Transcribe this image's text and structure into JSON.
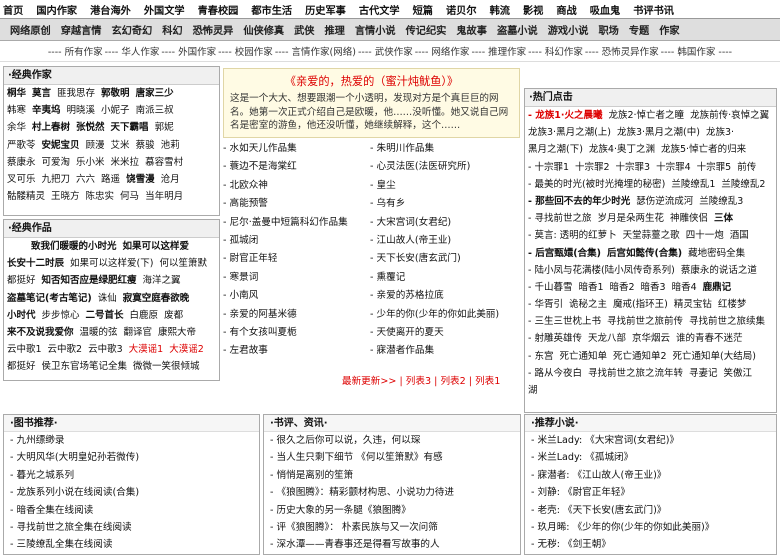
{
  "nav_top": [
    "首页",
    "国内作家",
    "港台海外",
    "外国文学",
    "青春校园",
    "都市生活",
    "历史军事",
    "古代文学",
    "短篇",
    "诺贝尔",
    "韩流",
    "影视",
    "商战",
    "吸血鬼",
    "书评书讯"
  ],
  "nav_second": [
    "网络原创",
    "穿越言情",
    "玄幻奇幻",
    "科幻",
    "恐怖灵异",
    "仙侠修真",
    "武侠",
    "推理",
    "言情小说",
    "传记纪实",
    "鬼故事",
    "盗墓小说",
    "游戏小说",
    "职场",
    "专题",
    "作家"
  ],
  "cat_links": [
    "---- 所有作家",
    "---- 华人作家",
    "---- 外国作家",
    "---- 校园作家",
    "---- 言情作家(网络)",
    "---- 武侠作家",
    "---- 网络作家",
    "---- 推理作家",
    "---- 科幻作家",
    "---- 恐怖灵异作家",
    "---- 韩国作家 ----"
  ],
  "classic_authors": {
    "title": "·经典作家",
    "rows": [
      [
        "桐华",
        "莫言",
        "匪我思存",
        "郭敬明",
        "唐家三少"
      ],
      [
        "韩寒",
        "辛夷坞",
        "明晓溪",
        "小妮子",
        "南派三叔"
      ],
      [
        "余华",
        "村上春树",
        "张悦然",
        "天下霸唱",
        "郭妮"
      ],
      [
        "严歌苓",
        "安妮宝贝",
        "顾漫",
        "艾米",
        "蔡骏",
        "池莉"
      ],
      [
        "蔡康永",
        "可爱淘",
        "乐小米",
        "米米拉",
        "慕容雪村"
      ],
      [
        "叉可乐",
        "九把刀",
        "六六",
        "路遥",
        "饶雪漫",
        "沧月"
      ],
      [
        "骷髅精灵",
        "王晓方",
        "陈忠实",
        "何马",
        "当年明月"
      ]
    ]
  },
  "classic_works": {
    "title": "·经典作品",
    "rows": [
      [
        "致我们暖暖的小时光",
        "如果可以这样爱"
      ],
      [
        "长安十二时辰",
        "如果可以这样爱(下)",
        "何以笙箫默"
      ],
      [
        "都挺好",
        "知否知否应是绿肥红瘦",
        "海洋之翼"
      ],
      [
        "盗墓笔记(考古笔记)",
        "诛仙",
        "寂寞空庭春欲晚"
      ],
      [
        "小时代",
        "步步惊心",
        "二号首长",
        "白鹿原",
        "废都"
      ],
      [
        "来不及说我爱你",
        "温暖的弦",
        "翻译官",
        "康熙大帝"
      ],
      [
        "云中歌1",
        "云中歌2",
        "云中歌3",
        "大漠谣1",
        "大漠谣2"
      ],
      [
        "都挺好",
        "侯卫东官场笔记全集",
        "微微一笑很倾城"
      ]
    ]
  },
  "featured": {
    "title": "《亲爱的，热爱的（蜜汁炖鱿鱼）》",
    "text": "这是一个大大、想要跟潮一个小透明，发现对方是个真巨巨的网名。她第一次正式介绍自己是欧暖，他……没听懂。她又说自己网名是密室的游鱼，他还没听懂，她继续解释，这个……"
  },
  "mid_left": [
    "- 水如天儿作品集",
    "- 蓑边不是海棠红",
    "- 北欧众神",
    "- 高能预警",
    "- 尼尔·盖曼中短篇科幻作品集",
    "- 孤城闭",
    "- 尉官正年轻",
    "- 寒景词",
    "- 小南风",
    "- 亲爱的阿基米德",
    "- 有个女孩叫夏栀",
    "- 左君故事"
  ],
  "mid_right": [
    "- 朱明川作品集",
    "- 心灵法医(法医研究所)",
    "- 皇尘",
    "- 乌有乡",
    "- 大宋宫词(女君纪)",
    "- 江山故人(帝王业)",
    "- 天下长安(唐玄武门)",
    "- 熏覆记",
    "- 亲爱的苏格拉底",
    "- 少年的你(少年的你如此美丽)",
    "- 天使离开的夏天",
    "- 寐潜者作品集"
  ],
  "mid_links": [
    "最新更新>>",
    "列表3",
    "列表2",
    "列表1"
  ],
  "hot": {
    "title": "·热门点击",
    "rows": [
      [
        {
          "t": "- 龙族1·火之晨曦",
          "c": "red b"
        },
        {
          "t": "龙族2·悼亡者之瞳"
        },
        {
          "t": "龙族前传·哀悼之翼"
        }
      ],
      [
        {
          "t": "龙族3·黑月之潮(上)"
        },
        {
          "t": "龙族3·黑月之潮(中)"
        },
        {
          "t": "龙族3·"
        }
      ],
      [
        {
          "t": "黑月之潮(下)"
        },
        {
          "t": "龙族4·奥丁之渊"
        },
        {
          "t": "龙族5·悼亡者的归来"
        }
      ],
      [
        {
          "t": "- 十宗罪1"
        },
        {
          "t": "十宗罪2"
        },
        {
          "t": "十宗罪3"
        },
        {
          "t": "十宗罪4"
        },
        {
          "t": "十宗罪5"
        },
        {
          "t": "前传"
        }
      ],
      [
        {
          "t": "- 最美的时光(被时光掩埋的秘密)"
        },
        {
          "t": "兰陵缭乱1"
        },
        {
          "t": "兰陵缭乱2"
        }
      ],
      [
        {
          "t": "- 那些回不去的年少时光",
          "c": "b"
        },
        {
          "t": "瑟伤逆流成河"
        },
        {
          "t": "兰陵缭乱3"
        }
      ],
      [
        {
          "t": "- 寻找前世之旅"
        },
        {
          "t": "岁月是朵两生花"
        },
        {
          "t": "神雕侠侣"
        },
        {
          "t": "三体",
          "c": "b"
        }
      ],
      [
        {
          "t": "- 莫言: 透明的红萝卜"
        },
        {
          "t": "天堂蒜薹之歌"
        },
        {
          "t": "四十一炮"
        },
        {
          "t": "酒国"
        }
      ],
      [
        {
          "t": "- 后宫甄嬛(合集)",
          "c": "b"
        },
        {
          "t": "后宫如懿传(合集)",
          "c": "b"
        },
        {
          "t": "藏地密码全集"
        }
      ],
      [
        {
          "t": "- 陆小凤与花满楼(陆小凤传奇系列)"
        },
        {
          "t": "蔡康永的说话之道"
        }
      ],
      [
        {
          "t": "- 千山暮雪"
        },
        {
          "t": "暗香1"
        },
        {
          "t": "暗香2"
        },
        {
          "t": "暗香3"
        },
        {
          "t": "暗香4"
        },
        {
          "t": "鹿鼎记",
          "c": "b"
        }
      ],
      [
        {
          "t": "- 华胥引"
        },
        {
          "t": "诡秘之主"
        },
        {
          "t": "魔戒(指环王)"
        },
        {
          "t": "精灵宝钻"
        },
        {
          "t": "红楼梦"
        }
      ],
      [
        {
          "t": "- 三生三世枕上书"
        },
        {
          "t": "寻找前世之旅前传"
        },
        {
          "t": "寻找前世之旅续集"
        }
      ],
      [
        {
          "t": "- 射雕英雄传"
        },
        {
          "t": "天龙八部"
        },
        {
          "t": "京华烟云"
        },
        {
          "t": "谁的青春不迷茫"
        }
      ],
      [
        {
          "t": "- 东宫"
        },
        {
          "t": "死亡通知单"
        },
        {
          "t": "死亡通知单2"
        },
        {
          "t": "死亡通知单(大结局)"
        }
      ],
      [
        {
          "t": "- 路从今夜白"
        },
        {
          "t": "寻找前世之旅之流年转"
        },
        {
          "t": "寻妻记"
        },
        {
          "t": "笑傲江"
        }
      ],
      [
        {
          "t": "湖"
        }
      ]
    ]
  },
  "bottom_left": {
    "title": "·图书推荐·",
    "items": [
      "- 九州缥缈录",
      "- 大明风华(大明皇妃孙若微传)",
      "- 暮光之城系列",
      "- 龙族系列小说在线阅读(合集)",
      "- 暗香全集在线阅读",
      "- 寻找前世之旅全集在线阅读",
      "- 三陵缭乱全集在线阅读"
    ]
  },
  "bottom_mid": {
    "title": "·书评、资讯·",
    "items": [
      "- 很久之后你可以说，久违，何以琛",
      "- 当人生只剩下细节 《何以笙箫默》有感",
      "- 悄悄是离别的笙箫",
      "- 《狼图腾》：精彩颤材构思、小说功力待进",
      "- 历史大象的另一条腿《狼图腾》",
      "- 评《狼图腾》：  朴素民族与又一次问筛",
      "- 深水潭——青春事还是得看写故事的人"
    ]
  },
  "bottom_right": {
    "title": "·推荐小说·",
    "items": [
      "- 米兰Lady: 《大宋宫词(女君纪)》",
      "- 米兰Lady: 《孤城闭》",
      "- 寐潜者: 《江山故人(帝王业)》",
      "- 刘静: 《尉官正年轻》",
      "- 老壳: 《天下长安(唐玄武门)》",
      "- 玖月晞: 《少年的你(少年的你如此美丽)》",
      "- 无秽: 《剑王朝》"
    ]
  }
}
